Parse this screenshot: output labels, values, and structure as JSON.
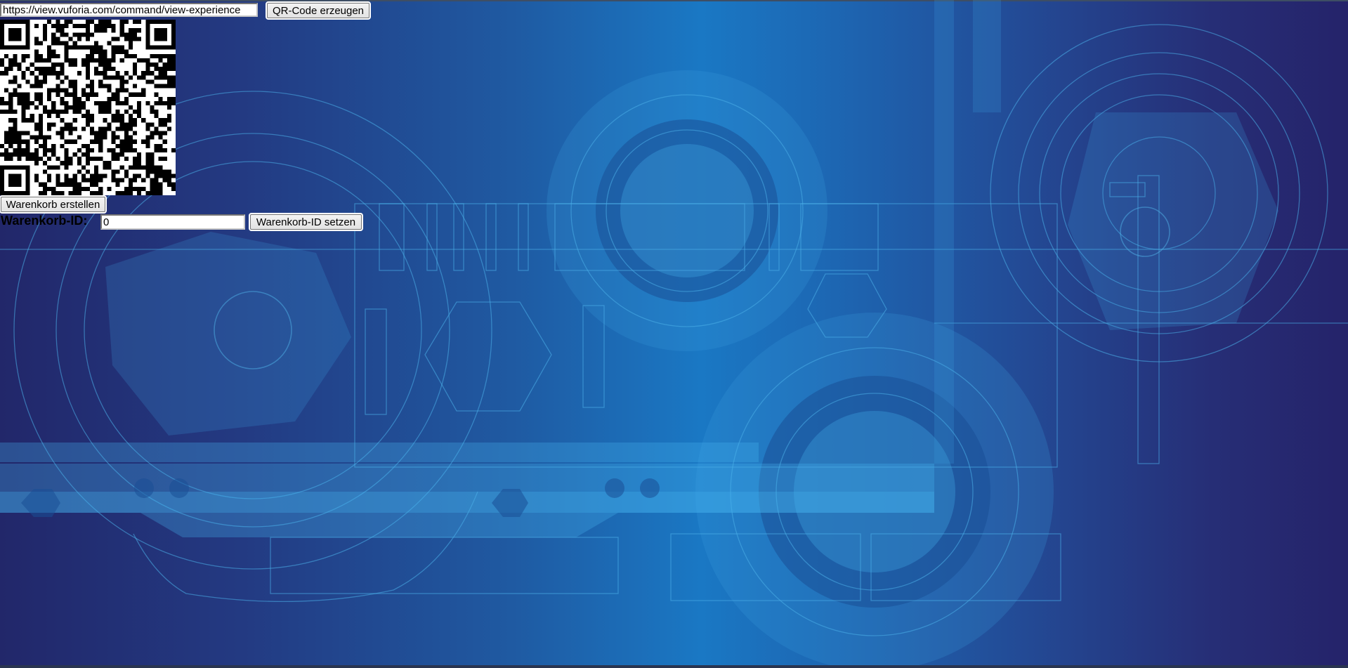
{
  "qr": {
    "url_value": "https://view.vuforia.com/command/view-experience",
    "generate_button_label": "QR-Code erzeugen"
  },
  "cart": {
    "create_button_label": "Warenkorb erstellen",
    "id_label": "Warenkorb-ID:",
    "id_value": "0",
    "set_id_button_label": "Warenkorb-ID setzen"
  },
  "colors": {
    "background_dark": "#22276a",
    "background_light": "#1a78c4",
    "circuit_lines": "#4aaee8"
  }
}
